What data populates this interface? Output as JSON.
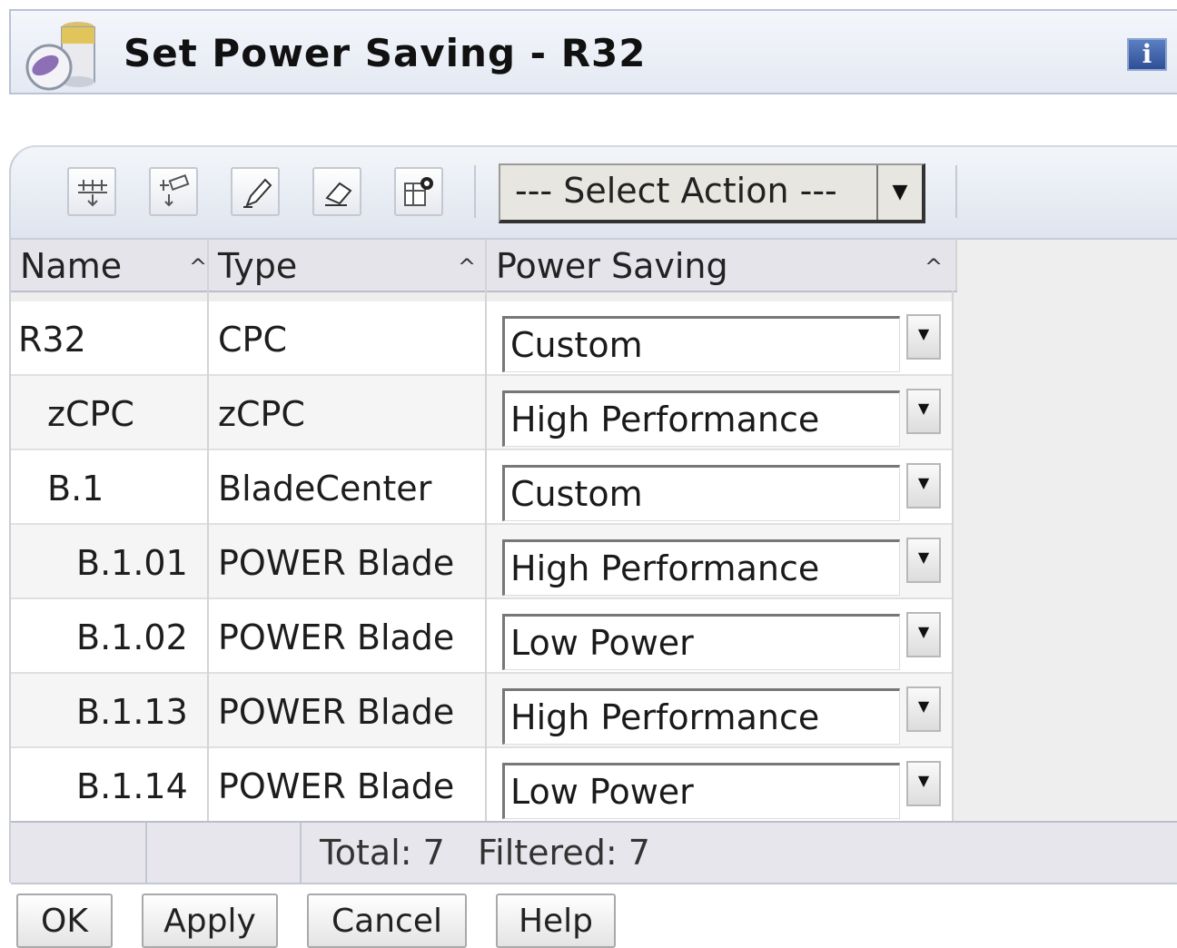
{
  "window": {
    "title": "Set Power Saving - R32",
    "icon": "power-battery-icon",
    "info_icon_label": "i"
  },
  "toolbar": {
    "buttons": [
      {
        "name": "expand-all-icon"
      },
      {
        "name": "clear-filter-icon"
      },
      {
        "name": "edit-pencil-icon"
      },
      {
        "name": "eraser-icon"
      },
      {
        "name": "configure-columns-icon"
      }
    ],
    "select_action": "--- Select Action ---"
  },
  "table": {
    "columns": [
      {
        "label": "Name",
        "sort": "^"
      },
      {
        "label": "Type",
        "sort": "^"
      },
      {
        "label": "Power Saving",
        "sort": "^"
      }
    ],
    "rows": [
      {
        "name": "R32",
        "type": "CPC",
        "power_saving": "Custom"
      },
      {
        "name": "zCPC",
        "type": "zCPC",
        "power_saving": "High Performance"
      },
      {
        "name": "B.1",
        "type": "BladeCenter",
        "power_saving": "Custom"
      },
      {
        "name": "B.1.01",
        "type": "POWER Blade",
        "power_saving": "High Performance"
      },
      {
        "name": "B.1.02",
        "type": "POWER Blade",
        "power_saving": "Low Power"
      },
      {
        "name": "B.1.13",
        "type": "POWER Blade",
        "power_saving": "High Performance"
      },
      {
        "name": "B.1.14",
        "type": "POWER Blade",
        "power_saving": "Low Power"
      }
    ]
  },
  "footer": {
    "status": "Total: 7   Filtered: 7"
  },
  "buttons": {
    "ok": "OK",
    "apply": "Apply",
    "cancel": "Cancel",
    "help": "Help"
  },
  "colors": {
    "title_bg": "#e4e9f3",
    "header_bg": "#e4e4ea",
    "info_icon": "#2e4f95"
  }
}
